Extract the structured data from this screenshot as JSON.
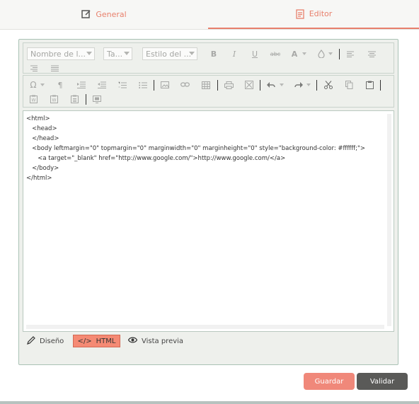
{
  "tabs": [
    {
      "label": "General",
      "icon": "edit-icon"
    },
    {
      "label": "Editor",
      "icon": "document-icon"
    }
  ],
  "toolbar": {
    "font_name_placeholder": "Nombre de l...",
    "font_size_placeholder": "Ta...",
    "style_placeholder": "Estilo del ...",
    "bold": "B",
    "italic": "I",
    "underline": "U",
    "strikethrough": "abc",
    "font_color": "A"
  },
  "code": {
    "lines": [
      "<html>",
      "   <head>",
      "   </head>",
      "   <body leftmargin=\"0\" topmargin=\"0\" marginwidth=\"0\" marginheight=\"0\" style=\"background-color: #ffffff;\">",
      "      <a target=\"_blank\" href=\"http://www.google.com/\">http://www.google.com/</a>",
      "   </body>",
      "</html>"
    ]
  },
  "modes": {
    "design": "Diseño",
    "html": "HTML",
    "html_icon": "</>",
    "preview": "Vista previa"
  },
  "actions": {
    "save": "Guardar",
    "validate": "Validar"
  },
  "colors": {
    "accent": "#e8806c",
    "save_bg": "#f0887a",
    "validate_bg": "#5a5a58"
  }
}
